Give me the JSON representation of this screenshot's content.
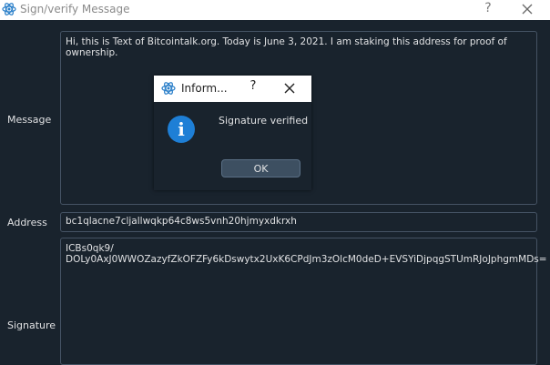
{
  "window": {
    "title": "Sign/verify Message",
    "help_label": "?"
  },
  "form": {
    "message_label": "Message",
    "message_value": "Hi, this is Text of Bitcointalk.org. Today is June 3, 2021. I am staking this address for proof of ownership.",
    "address_label": "Address",
    "address_value": "bc1qlacne7cljallwqkp64c8ws5vnh20hjmyxdkrxh",
    "signature_label": "Signature",
    "signature_value": "ICBs0qk9/\nDOLy0AxJ0WWOZazyfZkOFZFy6kDswytx2UxK6CPdJm3zOlcM0deD+EVSYiDjpqgSTUmRJoJphgmMDs="
  },
  "dialog": {
    "title": "Inform...",
    "help_label": "?",
    "message": "Signature verified",
    "ok_label": "OK"
  },
  "colors": {
    "background": "#19232d",
    "border": "#455364",
    "info_blue": "#1e7fd6"
  },
  "icons": [
    "electrum-app-icon",
    "close-icon",
    "info-icon"
  ]
}
